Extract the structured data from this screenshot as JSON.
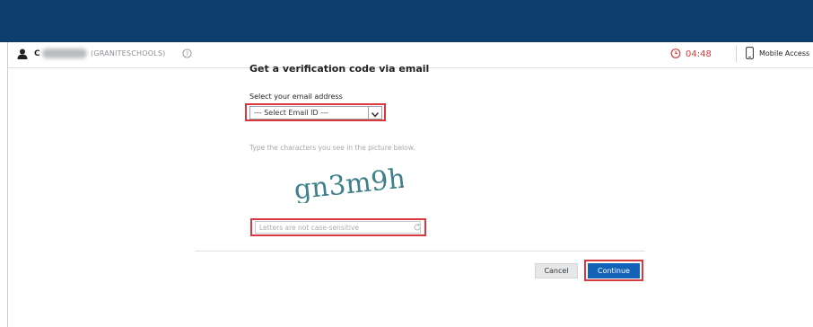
{
  "user": {
    "name_initial": "C",
    "domain": "(GRANITESCHOOLS)"
  },
  "session": {
    "timer": "04:48",
    "mobile_access_label": "Mobile Access"
  },
  "form": {
    "heading": "Get a verification code via email",
    "email_label": "Select your email address",
    "email_select_value": "--- Select Email ID ---",
    "captcha_hint": "Type the characters you see in the picture below.",
    "captcha_text": "gn3m9h",
    "captcha_input_placeholder": "Letters are not case-sensitive",
    "cancel_label": "Cancel",
    "continue_label": "Continue"
  },
  "colors": {
    "top_bar": "#0e3e6c",
    "timer": "#d23b3b",
    "primary_button": "#1263b8",
    "highlight": "#d9383f",
    "captcha": "#3d7f8a"
  },
  "icons": {
    "user": "user-icon",
    "help": "help-circle-icon",
    "timer": "clock-icon",
    "mobile": "mobile-phone-icon",
    "refresh": "refresh-icon",
    "dropdown": "chevron-down-icon"
  }
}
